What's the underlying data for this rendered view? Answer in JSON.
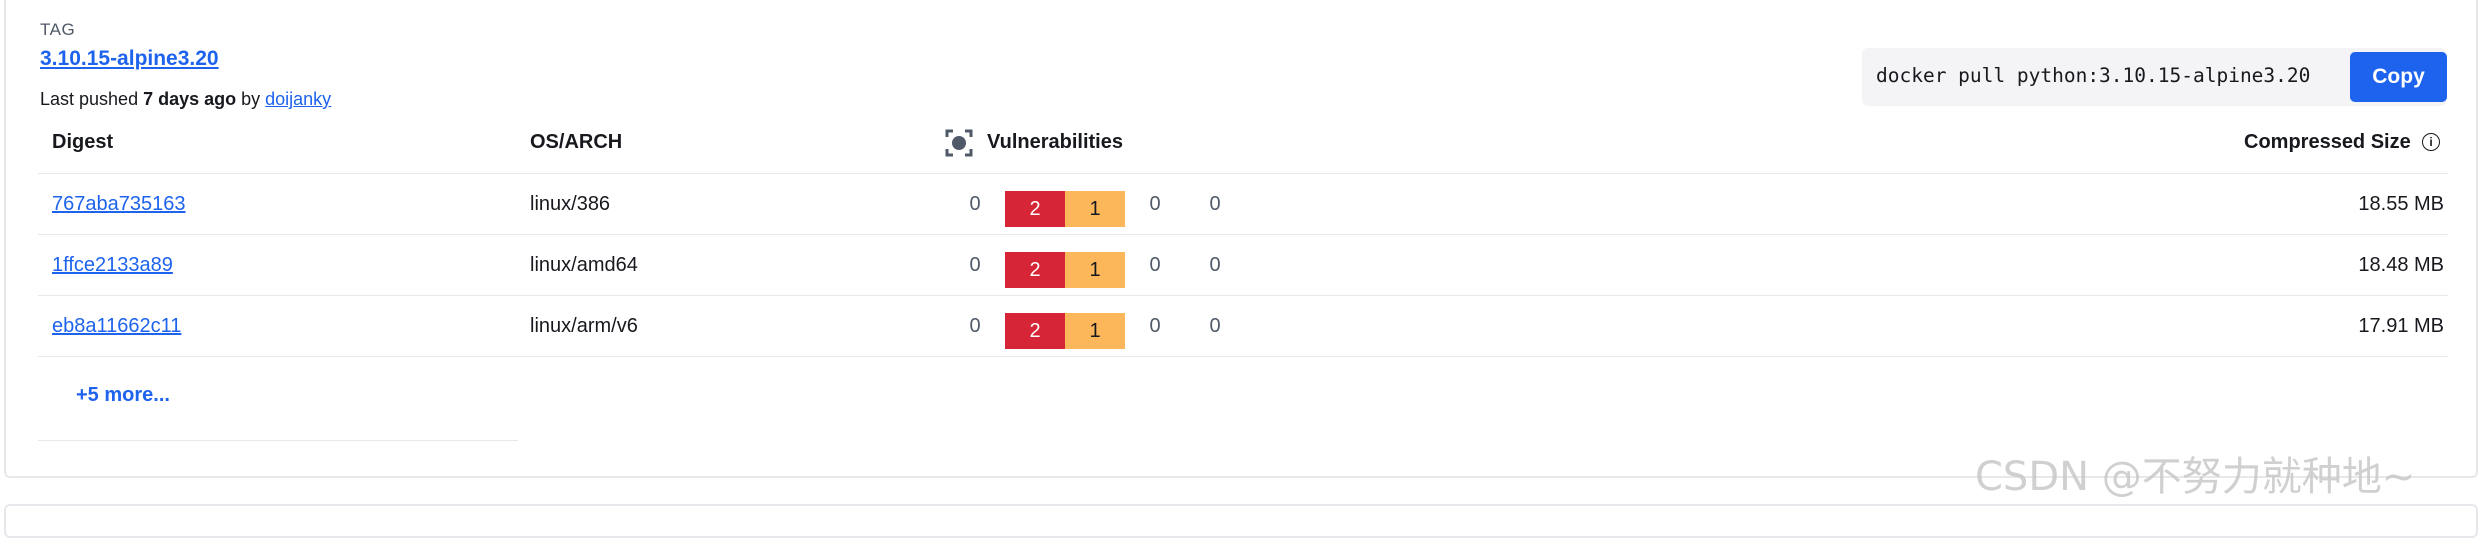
{
  "tag": {
    "label": "TAG",
    "name": "3.10.15-alpine3.20",
    "pushed_prefix": "Last pushed ",
    "pushed_when": "7 days ago",
    "pushed_by": " by ",
    "pushed_user": "doijanky"
  },
  "pull": {
    "command": "docker pull python:3.10.15-alpine3.20",
    "copy_label": "Copy"
  },
  "table": {
    "headers": {
      "digest": "Digest",
      "os_arch": "OS/ARCH",
      "vulnerabilities": "Vulnerabilities",
      "compressed_size": "Compressed Size"
    },
    "info_icon": "info-icon",
    "vuln_icon": "scan-icon",
    "colors": {
      "high": "#d52536",
      "medium": "#fcb75b",
      "link": "#1d63ed"
    },
    "rows": [
      {
        "digest": "767aba735163",
        "os": "linux/386",
        "critical": "0",
        "high": "2",
        "medium": "1",
        "low": "0",
        "unspecified": "0",
        "size": "18.55 MB"
      },
      {
        "digest": "1ffce2133a89",
        "os": "linux/amd64",
        "critical": "0",
        "high": "2",
        "medium": "1",
        "low": "0",
        "unspecified": "0",
        "size": "18.48 MB"
      },
      {
        "digest": "eb8a11662c11",
        "os": "linux/arm/v6",
        "critical": "0",
        "high": "2",
        "medium": "1",
        "low": "0",
        "unspecified": "0",
        "size": "17.91 MB"
      }
    ],
    "more_label": "+5 more..."
  },
  "watermark": "CSDN @不努力就种地~"
}
